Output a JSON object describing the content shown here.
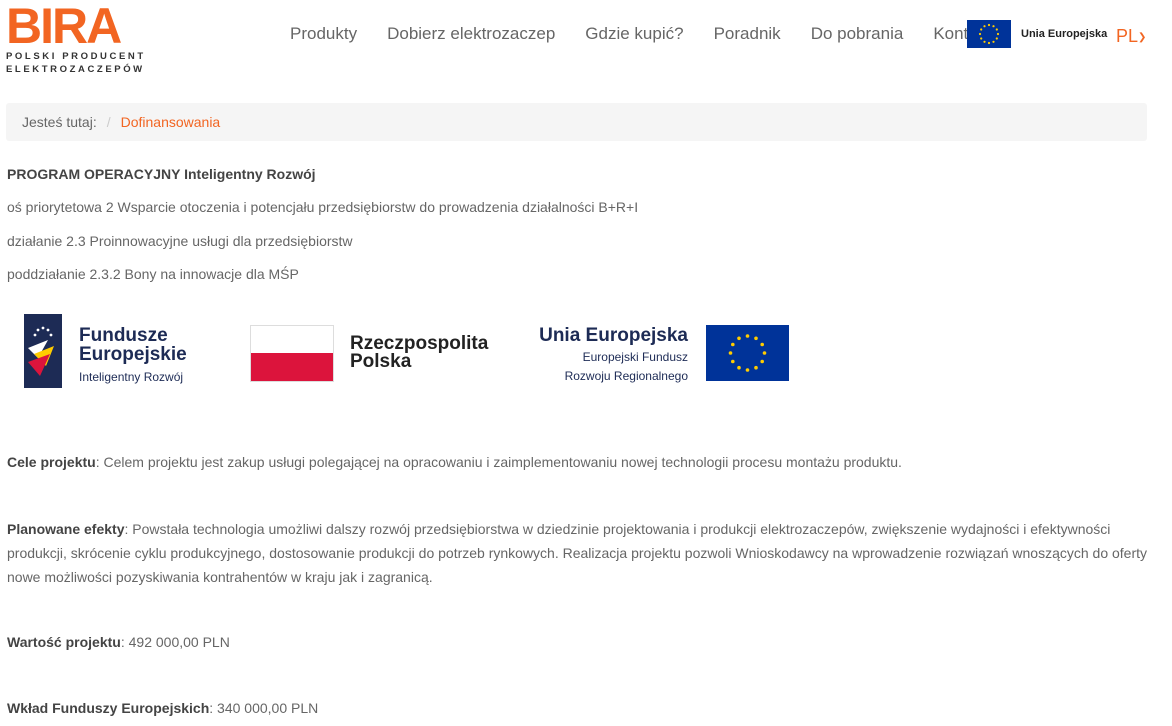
{
  "logo": {
    "word": "BIRA",
    "tagline_1": "POLSKI PRODUCENT",
    "tagline_2": "ELEKTROZACZEPÓW"
  },
  "nav": {
    "items": [
      "Produkty",
      "Dobierz elektrozaczep",
      "Gdzie kupić?",
      "Poradnik",
      "Do pobrania",
      "Kontakt"
    ]
  },
  "eu_badge": {
    "label": "Unia Europejska"
  },
  "language": {
    "current": "PL"
  },
  "breadcrumb": {
    "label": "Jesteś tutaj:",
    "separator": "/",
    "current": "Dofinansowania"
  },
  "program": {
    "title": "PROGRAM OPERACYJNY Inteligentny Rozwój",
    "line1": "oś priorytetowa 2 Wsparcie otoczenia i potencjału przedsiębiorstw do prowadzenia działalności B+R+I",
    "line2": "działanie 2.3 Proinnowacyjne usługi dla przedsiębiorstw",
    "line3": "poddziałanie 2.3.2 Bony na innowacje dla MŚP"
  },
  "funding_logos": {
    "fe_title_1": "Fundusze",
    "fe_title_2": "Europejskie",
    "fe_sub": "Inteligentny Rozwój",
    "pl_text_1": "Rzeczpospolita",
    "pl_text_2": "Polska",
    "ue_title": "Unia Europejska",
    "ue_sub_1": "Europejski Fundusz",
    "ue_sub_2": "Rozwoju Regionalnego"
  },
  "sections": {
    "goal_label": "Cele projektu",
    "goal_text": ": Celem projektu jest zakup usługi polegającej na opracowaniu i zaimplementowaniu nowej technologii procesu montażu produktu.",
    "effects_label": "Planowane efekty",
    "effects_text": ": Powstała technologia umożliwi dalszy rozwój przedsiębiorstwa w dziedzinie projektowania i produkcji elektrozaczepów, zwiększenie wydajności i efektywności produkcji, skrócenie cyklu produkcyjnego, dostosowanie produkcji do potrzeb rynkowych. Realizacja projektu pozwoli Wnioskodawcy na wprowadzenie rozwiązań wnoszących do oferty nowe możliwości pozyskiwania kontrahentów w kraju jak i zagranicą.",
    "value_label": "Wartość projektu",
    "value_text": ": 492 000,00 PLN",
    "funds_label": "Wkład Funduszy Europejskich",
    "funds_text": ": 340 000,00 PLN"
  },
  "colors": {
    "accent": "#f26522",
    "eu_blue": "#003399",
    "eu_star": "#ffcc00",
    "pl_red": "#dc143c"
  }
}
